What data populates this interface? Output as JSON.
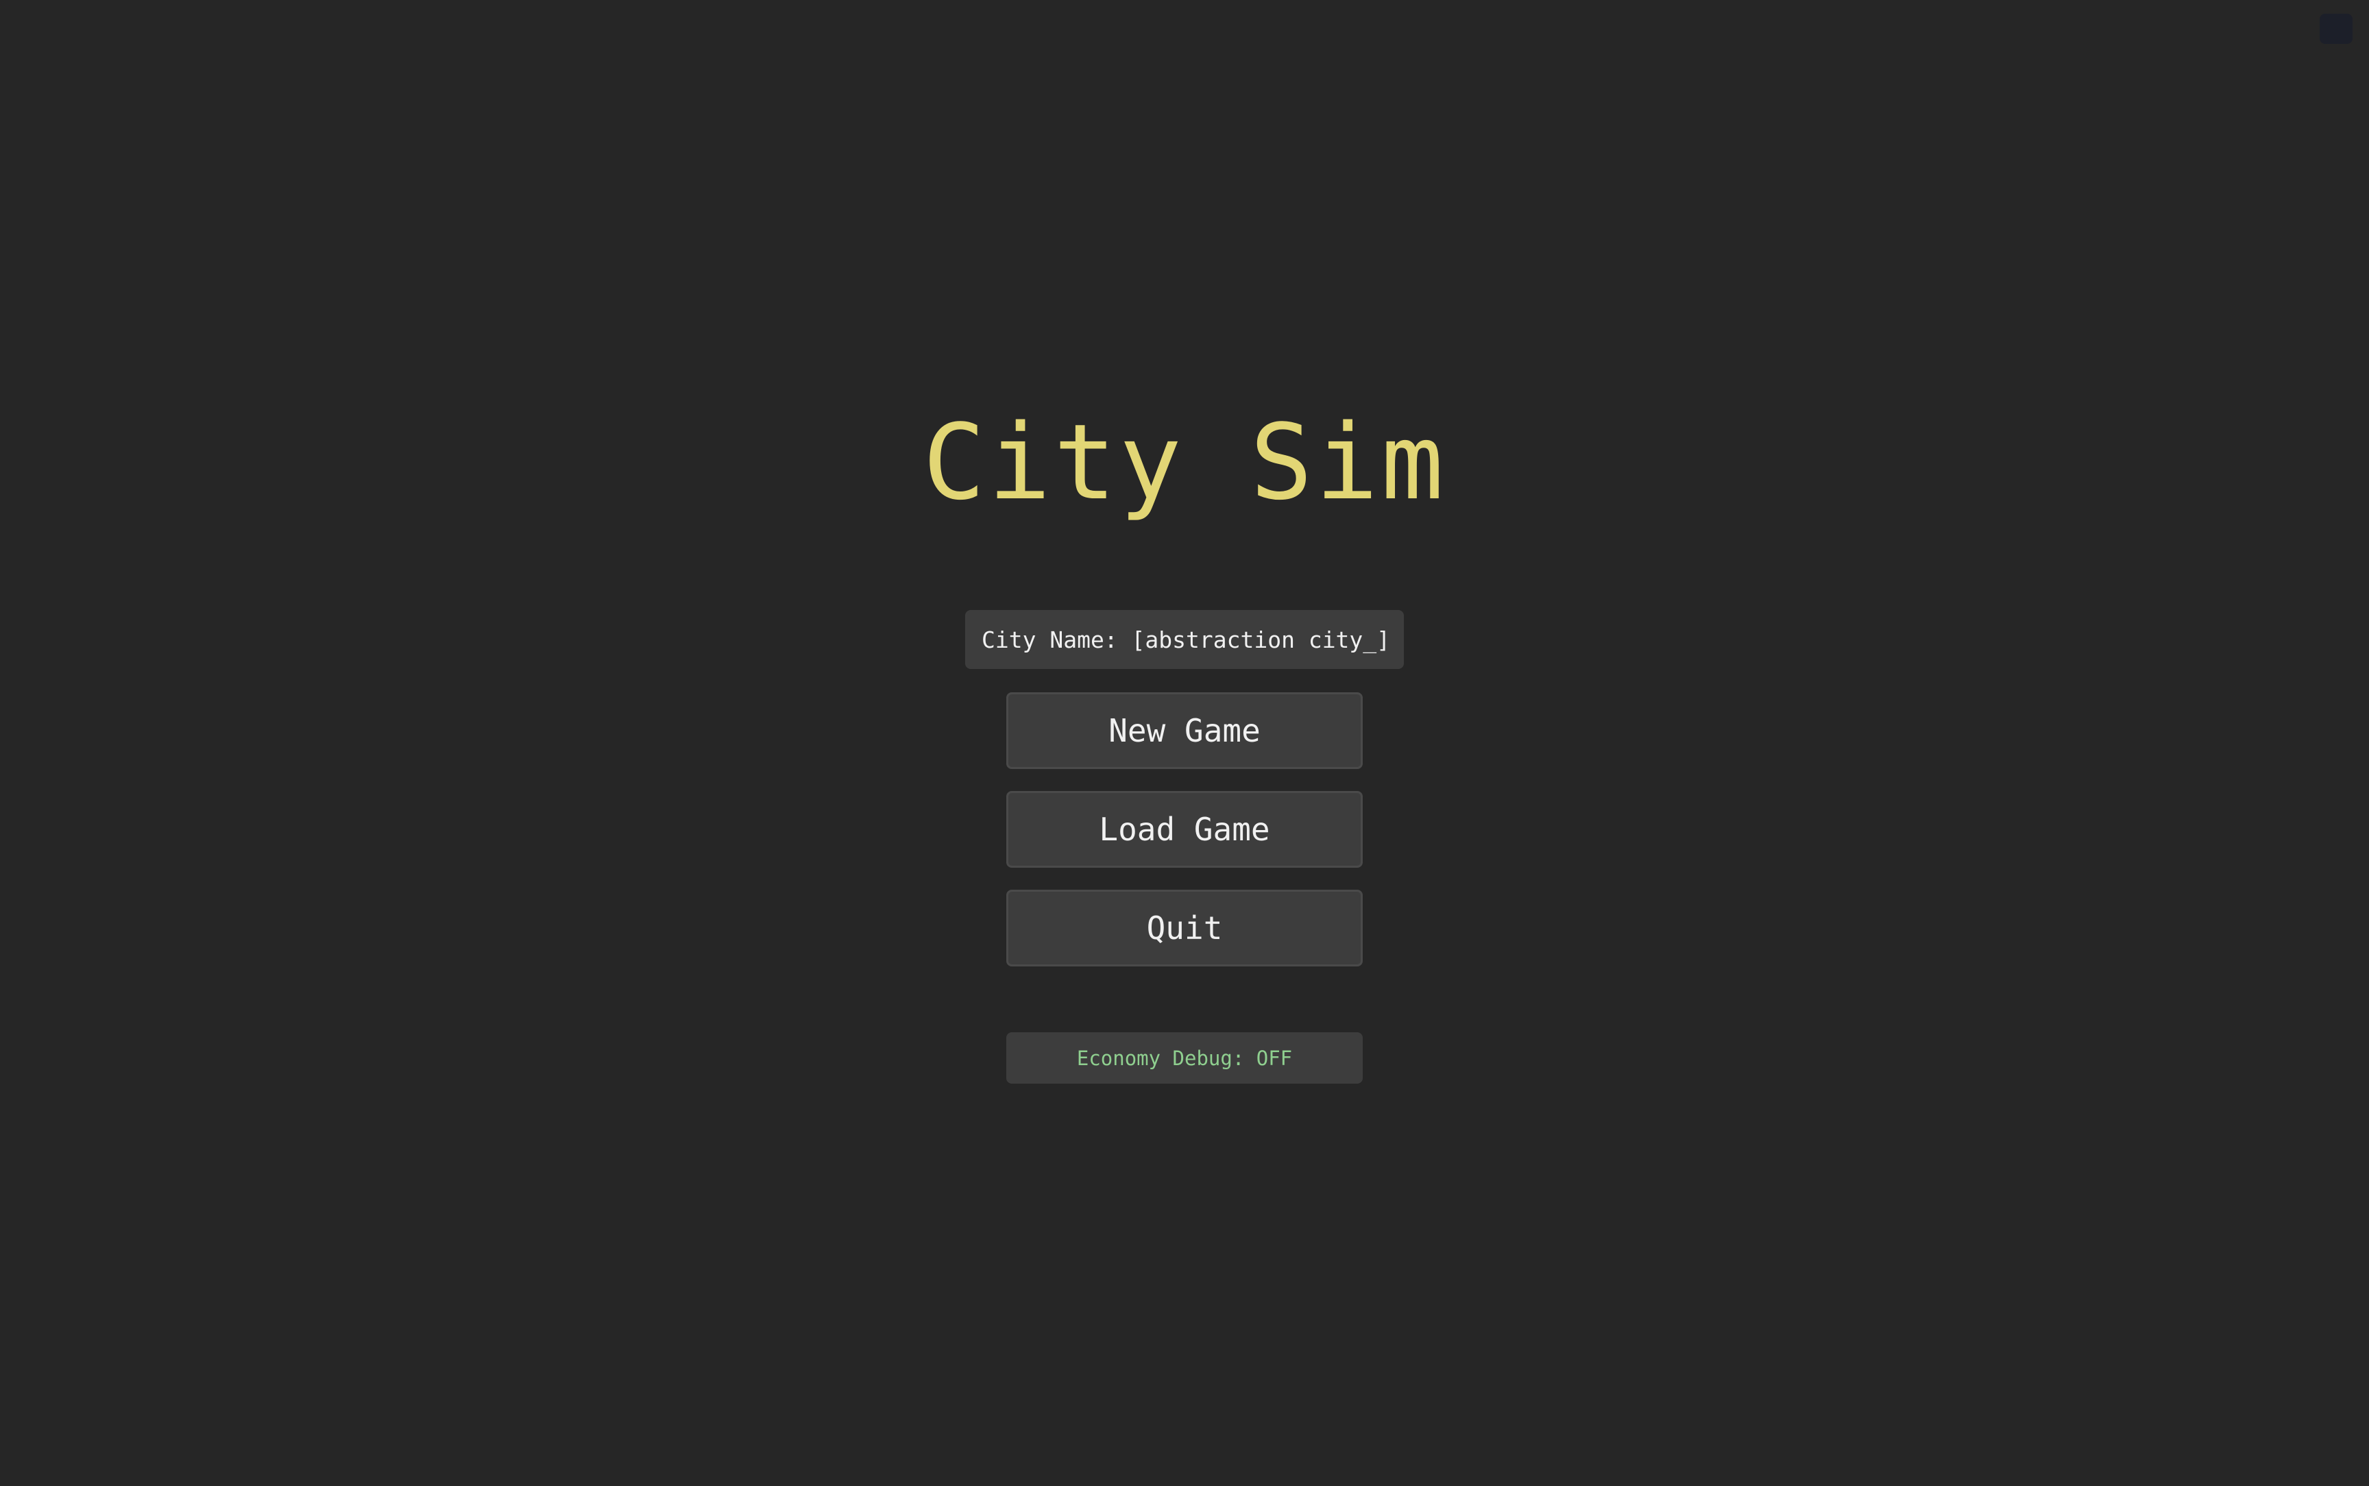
{
  "game": {
    "title": "City Sim"
  },
  "city_name_field": {
    "text": "City Name: [abstraction city_]"
  },
  "menu": {
    "new_game_label": "New Game",
    "load_game_label": "Load Game",
    "quit_label": "Quit"
  },
  "debug": {
    "economy_label": "Economy Debug: OFF"
  },
  "colors": {
    "background": "#262626",
    "title": "#e2d675",
    "button": "#3d3d3d",
    "debug_text": "#8fcf8f"
  }
}
